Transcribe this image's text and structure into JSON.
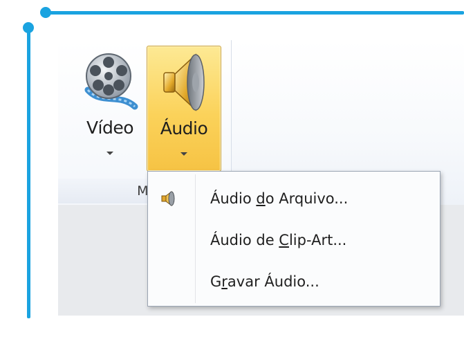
{
  "ribbon": {
    "group_label": "Mí",
    "buttons": {
      "video": {
        "label": "Vídeo",
        "icon": "film-reel-icon"
      },
      "audio": {
        "label": "Áudio",
        "icon": "speaker-icon",
        "state": "pressed"
      }
    }
  },
  "menu": {
    "items": [
      {
        "pre": "Áudio ",
        "accel": "d",
        "post": "o Arquivo...",
        "icon": "speaker-small-icon"
      },
      {
        "pre": "Áudio de ",
        "accel": "C",
        "post": "lip-Art...",
        "icon": null
      },
      {
        "pre": "G",
        "accel": "r",
        "post": "avar Áudio...",
        "icon": null
      }
    ]
  },
  "colors": {
    "accent_line": "#1aa3e0",
    "audio_button_fill": "#fbd25a",
    "audio_button_border": "#c9a13b"
  }
}
